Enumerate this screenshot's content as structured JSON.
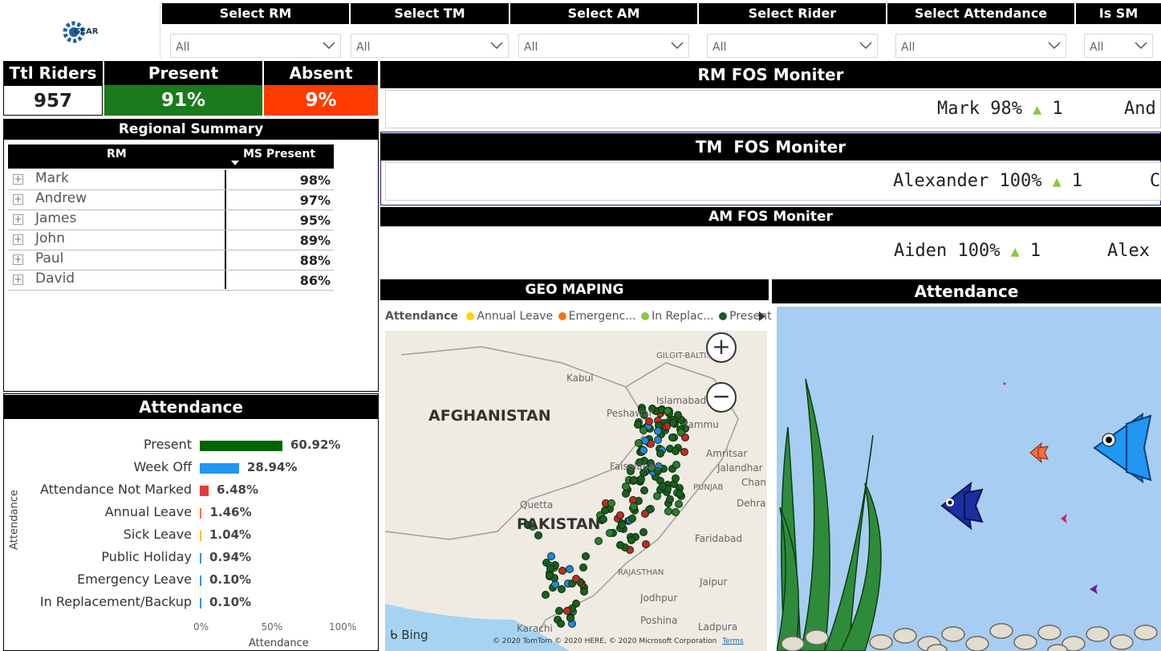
{
  "logo": {
    "text": "GEAR"
  },
  "slicers": [
    {
      "title": "Select RM",
      "value": "All"
    },
    {
      "title": "Select TM",
      "value": "All"
    },
    {
      "title": "Select AM",
      "value": "All"
    },
    {
      "title": "Select Rider",
      "value": "All"
    },
    {
      "title": "Select Attendance",
      "value": "All"
    },
    {
      "title": "Is SM",
      "value": "All"
    }
  ],
  "kpi": {
    "total_label": "Ttl Riders",
    "total_value": "957",
    "present_label": "Present",
    "present_value": "91%",
    "absent_label": "Absent",
    "absent_value": "9%"
  },
  "regional": {
    "title": "Regional Summary",
    "col_rm": "RM",
    "col_ms": "MS Present",
    "rows": [
      {
        "name": "Mark",
        "pct": "98%"
      },
      {
        "name": "Andrew",
        "pct": "97%"
      },
      {
        "name": "James",
        "pct": "95%"
      },
      {
        "name": "John",
        "pct": "89%"
      },
      {
        "name": "Paul",
        "pct": "88%"
      },
      {
        "name": "David",
        "pct": "86%"
      }
    ]
  },
  "monitors": {
    "rm": {
      "title": "RM FOS Moniter",
      "name": "Mark",
      "pct": "98%",
      "delta": "1",
      "next": "And"
    },
    "tm": {
      "title": "TM  FOS Moniter",
      "name": "Alexander",
      "pct": "100%",
      "delta": "1",
      "next": "C"
    },
    "am": {
      "title": "AM FOS Moniter",
      "name": "Aiden",
      "pct": "100%",
      "delta": "1",
      "next": "Alex"
    }
  },
  "attendance_chart_title": "Attendance",
  "chart_data": {
    "type": "bar",
    "orientation": "horizontal",
    "categories": [
      "Present",
      "Week Off",
      "Attendance Not Marked",
      "Annual Leave",
      "Sick Leave",
      "Public Holiday",
      "Emergency Leave",
      "In Replacement/Backup"
    ],
    "values": [
      60.92,
      28.94,
      6.48,
      1.46,
      1.04,
      0.94,
      0.1,
      0.1
    ],
    "value_labels": [
      "60.92%",
      "28.94%",
      "6.48%",
      "1.46%",
      "1.04%",
      "0.94%",
      "0.10%",
      "0.10%"
    ],
    "colors": [
      "#006400",
      "#2196f3",
      "#e53935",
      "#ff7043",
      "#fbc02d",
      "#2196f3",
      "#2196f3",
      "#2196f3"
    ],
    "xlabel": "Attendance",
    "ylabel": "Attendance",
    "xlim": [
      0,
      100
    ],
    "xticks": [
      "0%",
      "50%",
      "100%"
    ]
  },
  "geo": {
    "title": "GEO MAPING",
    "legend_title": "Attendance",
    "legend": [
      {
        "label": "Annual Leave",
        "color": "#ffd600"
      },
      {
        "label": "Emergenc...",
        "color": "#ff6f00"
      },
      {
        "label": "In Replac...",
        "color": "#8bc34a"
      },
      {
        "label": "Present",
        "color": "#1b5e20"
      }
    ],
    "labels": {
      "afghanistan": "AFGHANISTAN",
      "pakistan": "PAKISTAN",
      "kabul": "Kabul",
      "quetta": "Quetta",
      "karachi": "Karachi",
      "gilgit": "GILGIT-BALTI...",
      "islamabad": "Islamabad",
      "peshawar": "Peshawar",
      "jammu": "Jammu",
      "amritsar": "Amritsar",
      "faisalabad": "Faisalabad",
      "jalandhar": "Jalandhar",
      "punjab": "PUNJAB",
      "chan": "Chan",
      "dehra": "Dehra",
      "faridabad": "Faridabad",
      "rajasthan": "RAJASTHAN",
      "jaipur": "Jaipur",
      "jodhpur": "Jodhpur",
      "poshina": "Poshina",
      "ladpura": "Ladpura"
    },
    "attribution": "© 2020 TomTom © 2020 HERE, © 2020 Microsoft Corporation",
    "terms": "Terms",
    "bing": "Bing"
  },
  "aquarium_title": "Attendance"
}
